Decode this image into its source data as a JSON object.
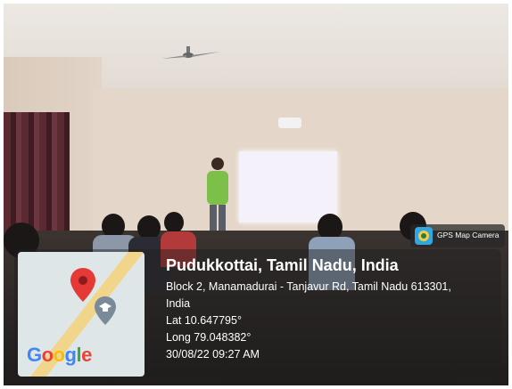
{
  "badge": {
    "label": "GPS Map Camera",
    "icon": "gps-map-camera-icon"
  },
  "location": {
    "title": "Pudukkottai, Tamil Nadu, India",
    "address": "Block 2, Manamadurai - Tanjavur Rd, Tamil Nadu 613301,",
    "country": "India",
    "lat": "Lat 10.647795°",
    "long": "Long 79.048382°",
    "datetime": "30/08/22 09:27 AM"
  },
  "map": {
    "brand": "Google",
    "pin_icon": "map-pin-icon",
    "place_icon": "graduation-cap-place-icon",
    "pin_color": "#e53935"
  }
}
